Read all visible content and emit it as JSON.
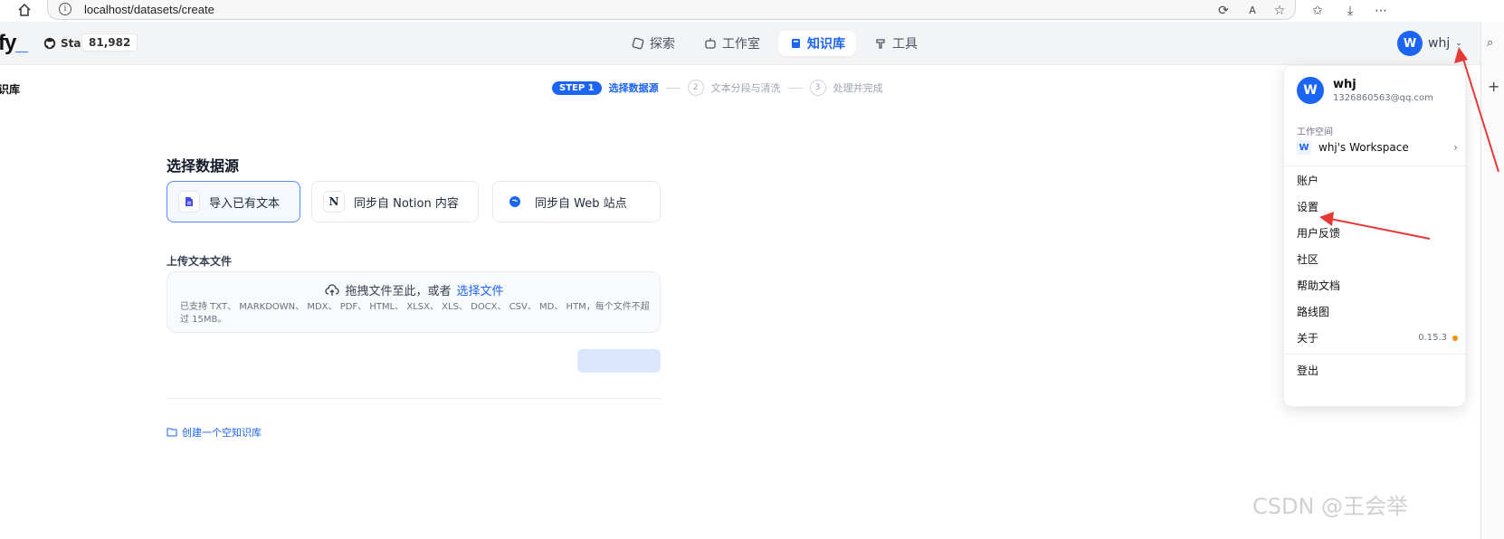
{
  "browser": {
    "url": "localhost/datasets/create"
  },
  "header": {
    "logo_text": "fy",
    "logo_suffix": "_",
    "github_star_label": "Star",
    "github_star_count": "81,982",
    "nav": [
      {
        "label": "探索",
        "icon": "compass-icon",
        "active": false
      },
      {
        "label": "工作室",
        "icon": "robot-icon",
        "active": false
      },
      {
        "label": "知识库",
        "icon": "book-icon",
        "active": true
      },
      {
        "label": "工具",
        "icon": "tool-icon",
        "active": false
      }
    ],
    "user_name": "whj",
    "user_initial": "W"
  },
  "subheader": {
    "breadcrumb": "识库",
    "steps": {
      "step1_pill": "STEP 1",
      "step1_label": "选择数据源",
      "step2_num": "2",
      "step2_label": "文本分段与清洗",
      "step3_num": "3",
      "step3_label": "处理并完成"
    }
  },
  "main": {
    "title": "选择数据源",
    "sources": [
      {
        "label": "导入已有文本",
        "icon": "document-icon"
      },
      {
        "label": "同步自 Notion 内容",
        "icon": "notion-icon"
      },
      {
        "label": "同步自 Web 站点",
        "icon": "globe-icon"
      }
    ],
    "upload_label": "上传文本文件",
    "dropzone_text": "拖拽文件至此，或者",
    "dropzone_link": "选择文件",
    "dropzone_hint": "已支持 TXT、 MARKDOWN、 MDX、 PDF、 HTML、 XLSX、 XLS、 DOCX、 CSV、 MD、 HTM，每个文件不超过 15MB。",
    "create_empty": "创建一个空知识库"
  },
  "dropdown": {
    "name": "whj",
    "email": "1326860563@qq.com",
    "initial": "W",
    "workspace_section": "工作空间",
    "workspace_initial": "W",
    "workspace_name": "whj's Workspace",
    "items": {
      "account": "账户",
      "settings": "设置",
      "feedback": "用户反馈",
      "community": "社区",
      "docs": "帮助文档",
      "roadmap": "路线图",
      "about": "关于",
      "version": "0.15.3",
      "logout": "登出"
    }
  },
  "watermark": "CSDN @王会举",
  "colors": {
    "accent": "#1c64f2",
    "annotation_arrow": "#e53935",
    "version_dot": "#f79009"
  }
}
